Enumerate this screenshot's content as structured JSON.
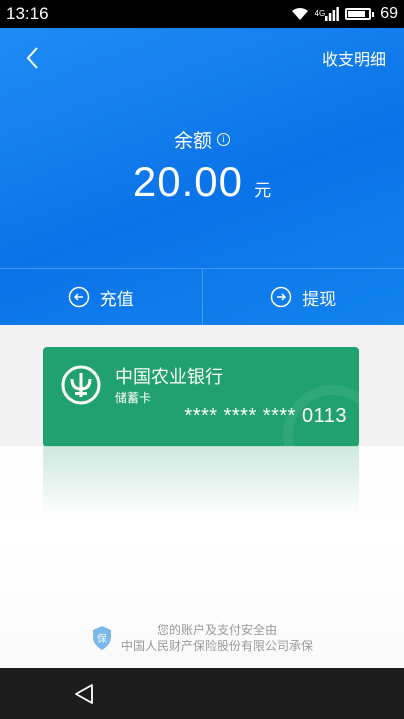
{
  "status_bar": {
    "time": "13:16",
    "network": "4G",
    "battery": "69"
  },
  "header": {
    "detail_link": "收支明细",
    "balance_label": "余额",
    "balance_amount": "20.00",
    "balance_unit": "元",
    "actions": [
      {
        "label": "充值",
        "icon": "arrow-left-circle-icon"
      },
      {
        "label": "提现",
        "icon": "arrow-right-circle-icon"
      }
    ]
  },
  "card": {
    "bank_name": "中国农业银行",
    "card_type": "储蓄卡",
    "card_number": "**** **** **** 0113",
    "color": "#21a16f"
  },
  "security": {
    "badge": "保",
    "line1": "您的账户及支付安全由",
    "line2": "中国人民财产保险股份有限公司承保"
  },
  "colors": {
    "header_blue": "#0a73e8",
    "card_green": "#21a16f"
  }
}
